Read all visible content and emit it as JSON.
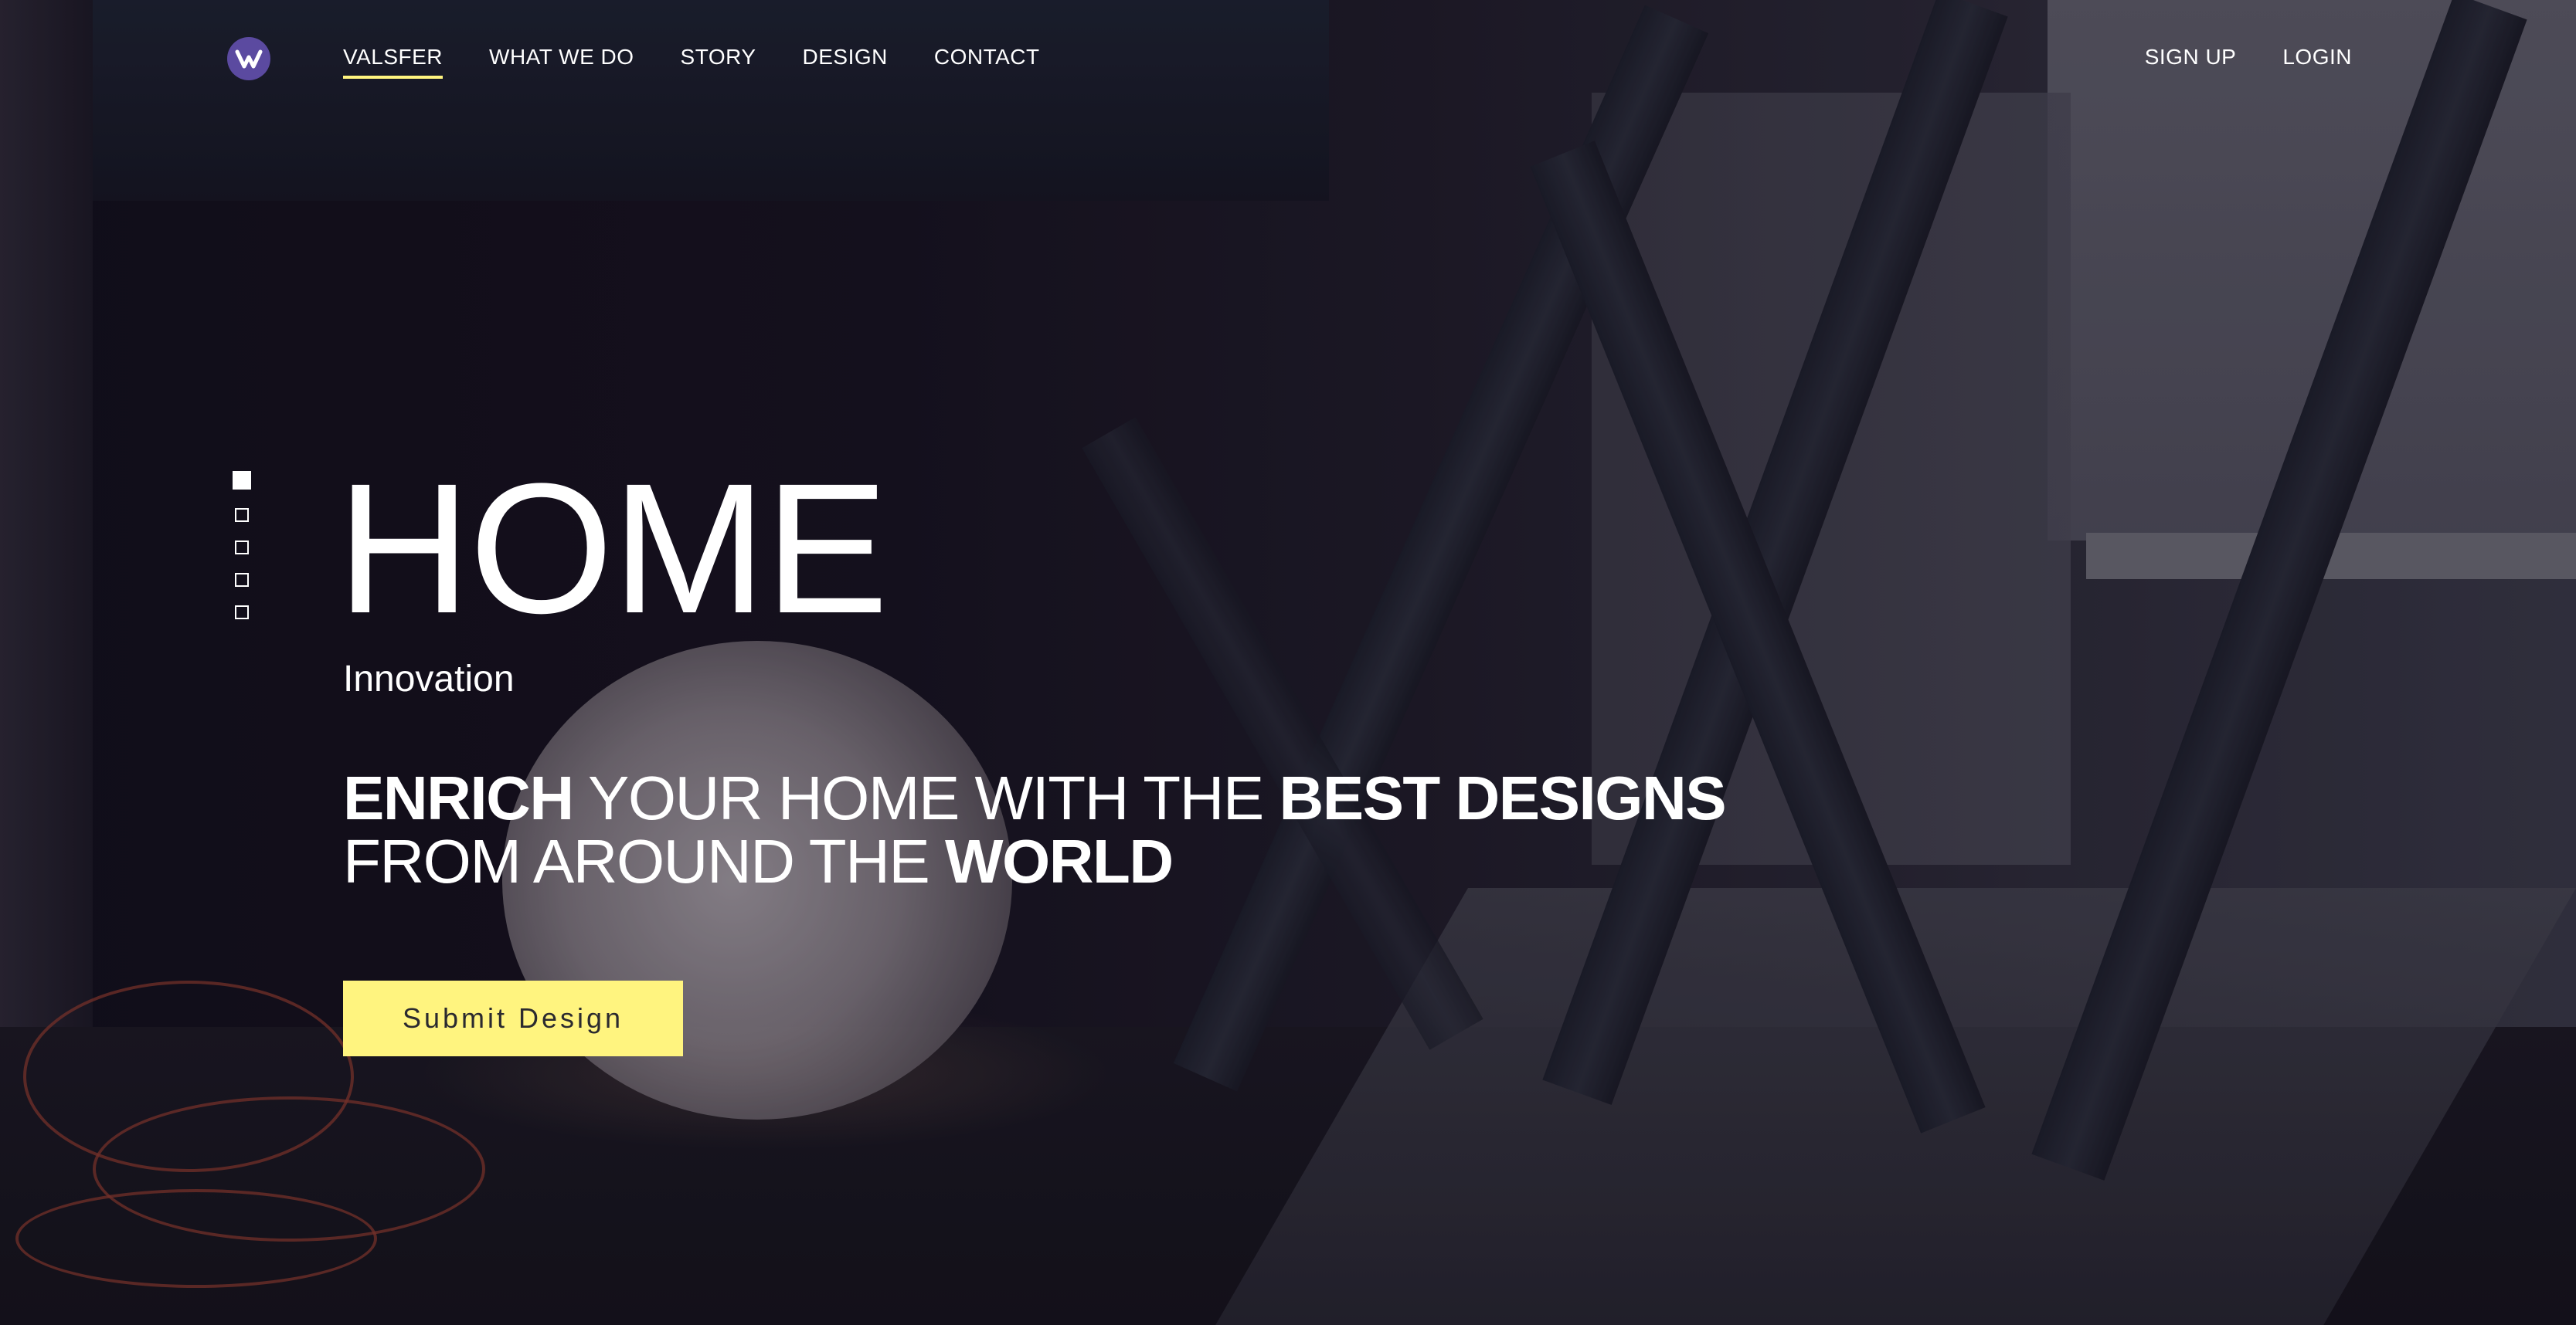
{
  "brand": {
    "logo_icon": "valsfer-logo-icon",
    "logo_color": "#5b4aa0"
  },
  "nav": {
    "items": [
      {
        "label": "VALSFER",
        "active": true
      },
      {
        "label": "WHAT WE DO",
        "active": false
      },
      {
        "label": "STORY",
        "active": false
      },
      {
        "label": "DESIGN",
        "active": false
      },
      {
        "label": "CONTACT",
        "active": false
      }
    ],
    "active_underline_color": "#fff47f"
  },
  "auth": {
    "signup_label": "SIGN UP",
    "login_label": "LOGIN"
  },
  "slides": {
    "count": 5,
    "active_index": 0
  },
  "hero": {
    "title": "HOME",
    "subtitle": "Innovation",
    "tagline": {
      "line1": [
        {
          "text": "ENRICH",
          "bold": true
        },
        {
          "text": " YOUR HOME WITH THE ",
          "bold": false
        },
        {
          "text": "BEST DESIGNS",
          "bold": true
        }
      ],
      "line2": [
        {
          "text": "FROM AROUND THE ",
          "bold": false
        },
        {
          "text": "WORLD",
          "bold": true
        }
      ]
    },
    "cta_label": "Submit Design",
    "cta_color": "#fff47f"
  }
}
